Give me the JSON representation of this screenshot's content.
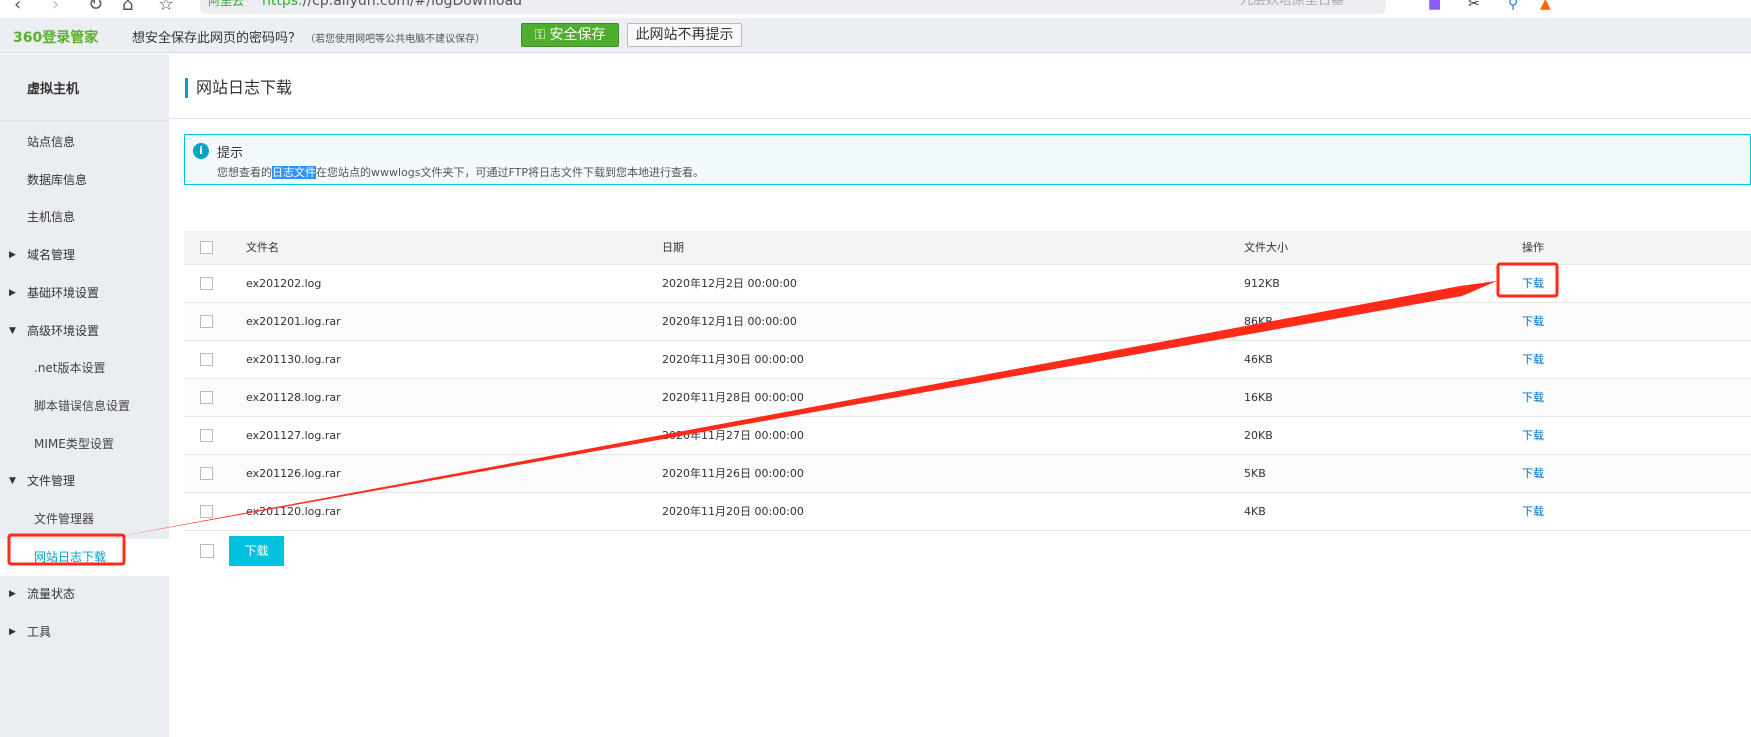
{
  "browser": {
    "nav": [
      "‹",
      "›",
      "↻",
      "⌂",
      "☆"
    ],
    "addr_tag": "阿里云",
    "addr_https": "https:",
    "url": "//cp.aliyun.com/#/logDownload",
    "search_placeholder": "九层妖塔原型古墓"
  },
  "pwbar": {
    "logo": "360登录管家",
    "question": "想安全保存此网页的密码吗？",
    "note": "（若您使用网吧等公共电脑不建议保存）",
    "save": "安全保存",
    "no": "此网站不再提示"
  },
  "sidebar": {
    "title": "虚拟主机",
    "items": [
      {
        "label": "站点信息",
        "type": "plain"
      },
      {
        "label": "数据库信息",
        "type": "plain"
      },
      {
        "label": "主机信息",
        "type": "plain"
      },
      {
        "label": "域名管理",
        "type": "collapsed"
      },
      {
        "label": "基础环境设置",
        "type": "collapsed"
      },
      {
        "label": "高级环境设置",
        "type": "expanded"
      },
      {
        "label": ".net版本设置",
        "type": "sub"
      },
      {
        "label": "脚本错误信息设置",
        "type": "sub"
      },
      {
        "label": "MIME类型设置",
        "type": "sub"
      },
      {
        "label": "文件管理",
        "type": "expanded"
      },
      {
        "label": "文件管理器",
        "type": "sub"
      },
      {
        "label": "网站日志下载",
        "type": "sub-active"
      },
      {
        "label": "流量状态",
        "type": "collapsed"
      },
      {
        "label": "工具",
        "type": "collapsed"
      }
    ]
  },
  "main": {
    "title": "网站日志下载",
    "tip": {
      "title": "提示",
      "pre": "您想查看的",
      "highlight": "日志文件",
      "post": "在您站点的wwwlogs文件夹下，可通过FTP将日志文件下载到您本地进行查看。"
    },
    "table": {
      "headers": [
        "文件名",
        "日期",
        "文件大小",
        "操作"
      ],
      "rows": [
        {
          "name": "ex201202.log",
          "date": "2020年12月2日 00:00:00",
          "size": "912KB",
          "action": "下载"
        },
        {
          "name": "ex201201.log.rar",
          "date": "2020年12月1日 00:00:00",
          "size": "86KB",
          "action": "下载"
        },
        {
          "name": "ex201130.log.rar",
          "date": "2020年11月30日 00:00:00",
          "size": "46KB",
          "action": "下载"
        },
        {
          "name": "ex201128.log.rar",
          "date": "2020年11月28日 00:00:00",
          "size": "16KB",
          "action": "下载"
        },
        {
          "name": "ex201127.log.rar",
          "date": "2020年11月27日 00:00:00",
          "size": "20KB",
          "action": "下载"
        },
        {
          "name": "ex201126.log.rar",
          "date": "2020年11月26日 00:00:00",
          "size": "5KB",
          "action": "下载"
        },
        {
          "name": "ex201120.log.rar",
          "date": "2020年11月20日 00:00:00",
          "size": "4KB",
          "action": "下载"
        }
      ]
    },
    "download_button": "下载"
  },
  "colors": {
    "accent": "#00a2ca",
    "annotation": "#ff2a1a",
    "save_green": "#4fae2e"
  }
}
